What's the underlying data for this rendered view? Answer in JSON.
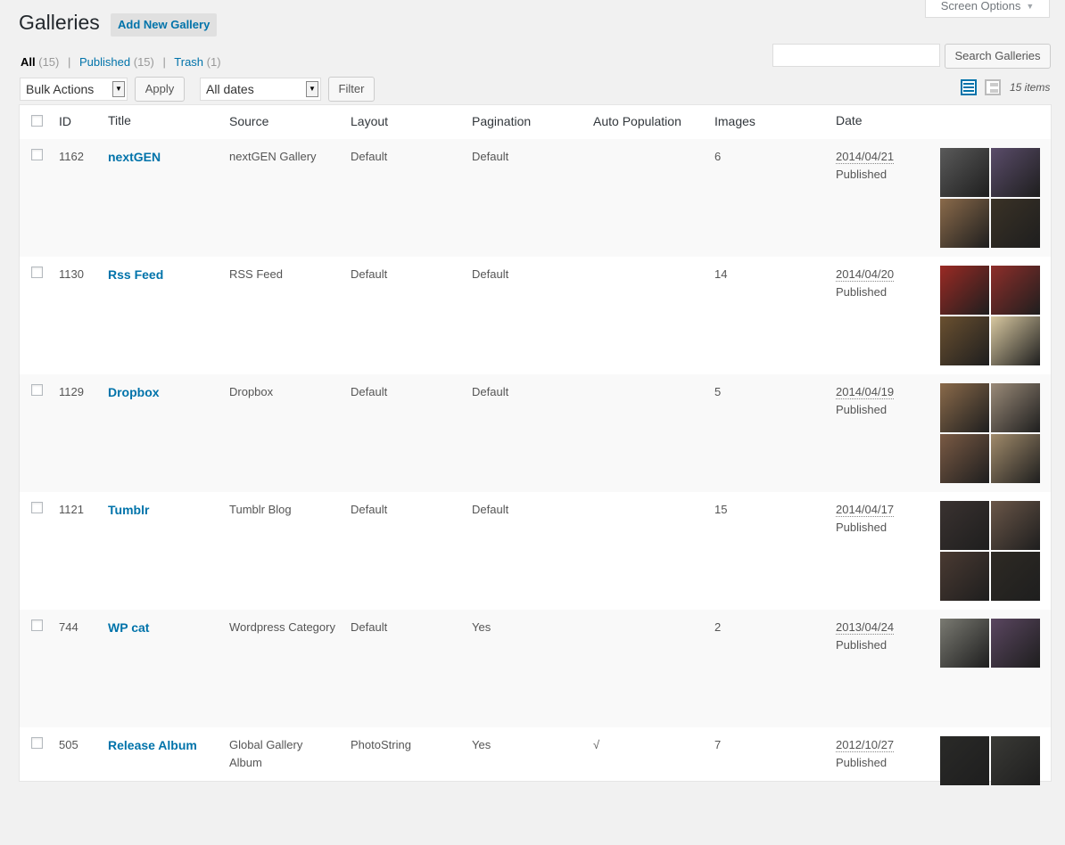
{
  "screen_options": "Screen Options",
  "page_title": "Galleries",
  "add_new_label": "Add New Gallery",
  "filters": {
    "all": "All",
    "all_count": "(15)",
    "published": "Published",
    "published_count": "(15)",
    "trash": "Trash",
    "trash_count": "(1)"
  },
  "search": {
    "value": "",
    "button": "Search Galleries"
  },
  "bulk_actions": "Bulk Actions",
  "apply": "Apply",
  "date_filter": "All dates",
  "filter": "Filter",
  "items_count": "15 items",
  "columns": {
    "id": "ID",
    "title": "Title",
    "source": "Source",
    "layout": "Layout",
    "pagination": "Pagination",
    "auto_population": "Auto Population",
    "images": "Images",
    "date": "Date"
  },
  "rows": [
    {
      "id": "1162",
      "title": "nextGEN",
      "source": "nextGEN Gallery",
      "layout": "Default",
      "pagination": "Default",
      "auto": "",
      "images": "6",
      "date": "2014/04/21",
      "status": "Published",
      "thumbs": [
        "#5a5a5a",
        "#5a4c6a",
        "#8a6a4a",
        "#3a3226"
      ]
    },
    {
      "id": "1130",
      "title": "Rss Feed",
      "source": "RSS Feed",
      "layout": "Default",
      "pagination": "Default",
      "auto": "",
      "images": "14",
      "date": "2014/04/20",
      "status": "Published",
      "thumbs": [
        "#9a2a24",
        "#8e2e2a",
        "#6a5030",
        "#d8c8a0"
      ]
    },
    {
      "id": "1129",
      "title": "Dropbox",
      "source": "Dropbox",
      "layout": "Default",
      "pagination": "Default",
      "auto": "",
      "images": "5",
      "date": "2014/04/19",
      "status": "Published",
      "thumbs": [
        "#8a6a4a",
        "#9a8a78",
        "#7a5a44",
        "#a08a6a"
      ]
    },
    {
      "id": "1121",
      "title": "Tumblr",
      "source": "Tumblr Blog",
      "layout": "Default",
      "pagination": "Default",
      "auto": "",
      "images": "15",
      "date": "2014/04/17",
      "status": "Published",
      "thumbs": [
        "#3a3230",
        "#6a5648",
        "#4a3a32",
        "#2e2a24"
      ]
    },
    {
      "id": "744",
      "title": "WP cat",
      "source": "Wordpress Category",
      "layout": "Default",
      "pagination": "Yes",
      "auto": "",
      "images": "2",
      "date": "2013/04/24",
      "status": "Published",
      "thumbs": [
        "#7a7a72",
        "#5a4660"
      ]
    },
    {
      "id": "505",
      "title": "Release Album",
      "source": "Global Gallery Album",
      "layout": "PhotoString",
      "pagination": "Yes",
      "auto": "√",
      "images": "7",
      "date": "2012/10/27",
      "status": "Published",
      "thumbs": [
        "#2a2a28",
        "#3a3a36"
      ]
    }
  ]
}
